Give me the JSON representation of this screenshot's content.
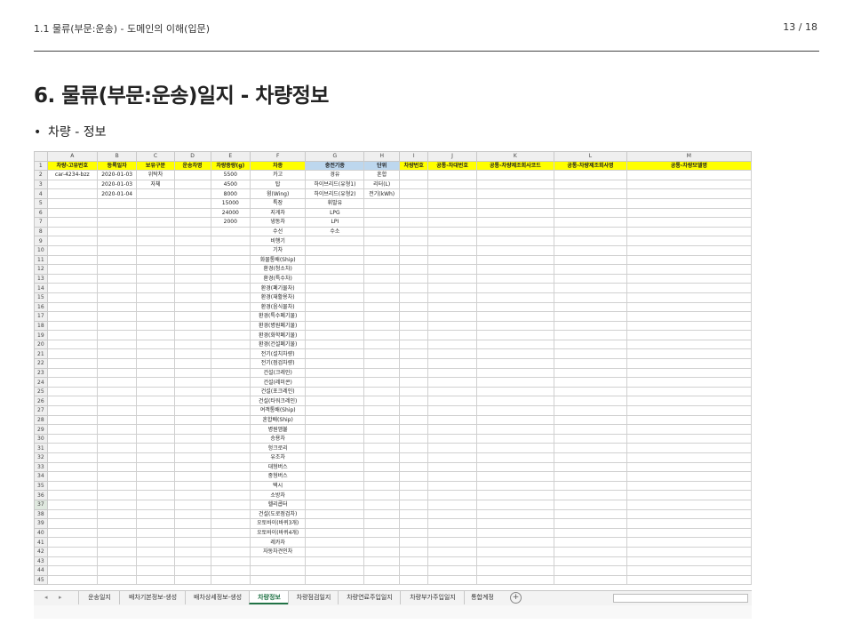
{
  "header": {
    "breadcrumb": "1.1 물류(부문:운송) - 도메인의 이해(입문)",
    "page": "13 / 18"
  },
  "title": "6. 물류(부문:운송)일지 - 차량정보",
  "bullet": "차량 - 정보",
  "sheet": {
    "columns": [
      "A",
      "B",
      "C",
      "D",
      "E",
      "F",
      "G",
      "H",
      "I",
      "J",
      "K",
      "L",
      "M"
    ],
    "headers": [
      "차량-고유번호",
      "등록일자",
      "보유구분",
      "운송차명",
      "차량중량(g)",
      "차종",
      "충전기종",
      "단위",
      "차량번호",
      "공통-차대번호",
      "공통-차량제조회사코드",
      "공통-차량제조회사명",
      "공통-차량모델명"
    ],
    "rows": [
      [
        "car-4234-bzz",
        "2020-01-03",
        "위탁차",
        "",
        "5500",
        "카고",
        "경유",
        "혼합",
        "",
        "",
        "",
        "",
        ""
      ],
      [
        "",
        "2020-01-03",
        "자체",
        "",
        "4500",
        "탑",
        "하이브리드(유형1)",
        "리터(L)",
        "",
        "",
        "",
        "",
        ""
      ],
      [
        "",
        "2020-01-04",
        "",
        "",
        "8000",
        "윙(Wing)",
        "하이브리드(유형2)",
        "전기(kWh)",
        "",
        "",
        "",
        "",
        ""
      ],
      [
        "",
        "",
        "",
        "",
        "15000",
        "특장",
        "휘발유",
        "",
        "",
        "",
        "",
        "",
        ""
      ],
      [
        "",
        "",
        "",
        "",
        "24000",
        "지게차",
        "LPG",
        "",
        "",
        "",
        "",
        "",
        ""
      ],
      [
        "",
        "",
        "",
        "",
        "2000",
        "냉동차",
        "LPI",
        "",
        "",
        "",
        "",
        "",
        ""
      ],
      [
        "",
        "",
        "",
        "",
        "",
        "수선",
        "수소",
        "",
        "",
        "",
        "",
        "",
        ""
      ],
      [
        "",
        "",
        "",
        "",
        "",
        "비행기",
        "",
        "",
        "",
        "",
        "",
        "",
        ""
      ],
      [
        "",
        "",
        "",
        "",
        "",
        "기차",
        "",
        "",
        "",
        "",
        "",
        "",
        ""
      ],
      [
        "",
        "",
        "",
        "",
        "",
        "화물통배(Ship)",
        "",
        "",
        "",
        "",
        "",
        "",
        ""
      ],
      [
        "",
        "",
        "",
        "",
        "",
        "환경(청소차)",
        "",
        "",
        "",
        "",
        "",
        "",
        ""
      ],
      [
        "",
        "",
        "",
        "",
        "",
        "환경(특수차)",
        "",
        "",
        "",
        "",
        "",
        "",
        ""
      ],
      [
        "",
        "",
        "",
        "",
        "",
        "환경(폐기물차)",
        "",
        "",
        "",
        "",
        "",
        "",
        ""
      ],
      [
        "",
        "",
        "",
        "",
        "",
        "환경(재활용차)",
        "",
        "",
        "",
        "",
        "",
        "",
        ""
      ],
      [
        "",
        "",
        "",
        "",
        "",
        "환경(음식물차)",
        "",
        "",
        "",
        "",
        "",
        "",
        ""
      ],
      [
        "",
        "",
        "",
        "",
        "",
        "환경(특수폐기물)",
        "",
        "",
        "",
        "",
        "",
        "",
        ""
      ],
      [
        "",
        "",
        "",
        "",
        "",
        "환경(병원폐기물)",
        "",
        "",
        "",
        "",
        "",
        "",
        ""
      ],
      [
        "",
        "",
        "",
        "",
        "",
        "환경(화학폐기물)",
        "",
        "",
        "",
        "",
        "",
        "",
        ""
      ],
      [
        "",
        "",
        "",
        "",
        "",
        "환경(건설폐기물)",
        "",
        "",
        "",
        "",
        "",
        "",
        ""
      ],
      [
        "",
        "",
        "",
        "",
        "",
        "전기(설치차량)",
        "",
        "",
        "",
        "",
        "",
        "",
        ""
      ],
      [
        "",
        "",
        "",
        "",
        "",
        "전기(점검차량)",
        "",
        "",
        "",
        "",
        "",
        "",
        ""
      ],
      [
        "",
        "",
        "",
        "",
        "",
        "건설(크레인)",
        "",
        "",
        "",
        "",
        "",
        "",
        ""
      ],
      [
        "",
        "",
        "",
        "",
        "",
        "건설(레미콘)",
        "",
        "",
        "",
        "",
        "",
        "",
        ""
      ],
      [
        "",
        "",
        "",
        "",
        "",
        "건설(포크레인)",
        "",
        "",
        "",
        "",
        "",
        "",
        ""
      ],
      [
        "",
        "",
        "",
        "",
        "",
        "건설(타워크레인)",
        "",
        "",
        "",
        "",
        "",
        "",
        ""
      ],
      [
        "",
        "",
        "",
        "",
        "",
        "여객통배(Ship)",
        "",
        "",
        "",
        "",
        "",
        "",
        ""
      ],
      [
        "",
        "",
        "",
        "",
        "",
        "혼합배(Ship)",
        "",
        "",
        "",
        "",
        "",
        "",
        ""
      ],
      [
        "",
        "",
        "",
        "",
        "",
        "병원앰뷸",
        "",
        "",
        "",
        "",
        "",
        "",
        ""
      ],
      [
        "",
        "",
        "",
        "",
        "",
        "승용차",
        "",
        "",
        "",
        "",
        "",
        "",
        ""
      ],
      [
        "",
        "",
        "",
        "",
        "",
        "헝크로리",
        "",
        "",
        "",
        "",
        "",
        "",
        ""
      ],
      [
        "",
        "",
        "",
        "",
        "",
        "유조차",
        "",
        "",
        "",
        "",
        "",
        "",
        ""
      ],
      [
        "",
        "",
        "",
        "",
        "",
        "대형버스",
        "",
        "",
        "",
        "",
        "",
        "",
        ""
      ],
      [
        "",
        "",
        "",
        "",
        "",
        "중형버스",
        "",
        "",
        "",
        "",
        "",
        "",
        ""
      ],
      [
        "",
        "",
        "",
        "",
        "",
        "택시",
        "",
        "",
        "",
        "",
        "",
        "",
        ""
      ],
      [
        "",
        "",
        "",
        "",
        "",
        "소방차",
        "",
        "",
        "",
        "",
        "",
        "",
        ""
      ],
      [
        "",
        "",
        "",
        "",
        "",
        "헬리콥터",
        "",
        "",
        "",
        "",
        "",
        "",
        ""
      ],
      [
        "",
        "",
        "",
        "",
        "",
        "건설(도로점검차)",
        "",
        "",
        "",
        "",
        "",
        "",
        ""
      ],
      [
        "",
        "",
        "",
        "",
        "",
        "오토바이(바퀴3개)",
        "",
        "",
        "",
        "",
        "",
        "",
        ""
      ],
      [
        "",
        "",
        "",
        "",
        "",
        "오토바이(바퀴4개)",
        "",
        "",
        "",
        "",
        "",
        "",
        ""
      ],
      [
        "",
        "",
        "",
        "",
        "",
        "레카차",
        "",
        "",
        "",
        "",
        "",
        "",
        ""
      ],
      [
        "",
        "",
        "",
        "",
        "",
        "자동차견인차",
        "",
        "",
        "",
        "",
        "",
        "",
        ""
      ],
      [
        "",
        "",
        "",
        "",
        "",
        "",
        "",
        "",
        "",
        "",
        "",
        "",
        ""
      ],
      [
        "",
        "",
        "",
        "",
        "",
        "",
        "",
        "",
        "",
        "",
        "",
        "",
        ""
      ],
      [
        "",
        "",
        "",
        "",
        "",
        "",
        "",
        "",
        "",
        "",
        "",
        "",
        ""
      ]
    ],
    "tabs": [
      "운송일지",
      "배차기본정보-생성",
      "배차상세정보-생성",
      "차량정보",
      "차량점검일지",
      "차량연료주입일지",
      "차량부가주입일지",
      "통합계정"
    ],
    "active_tab": 3
  }
}
